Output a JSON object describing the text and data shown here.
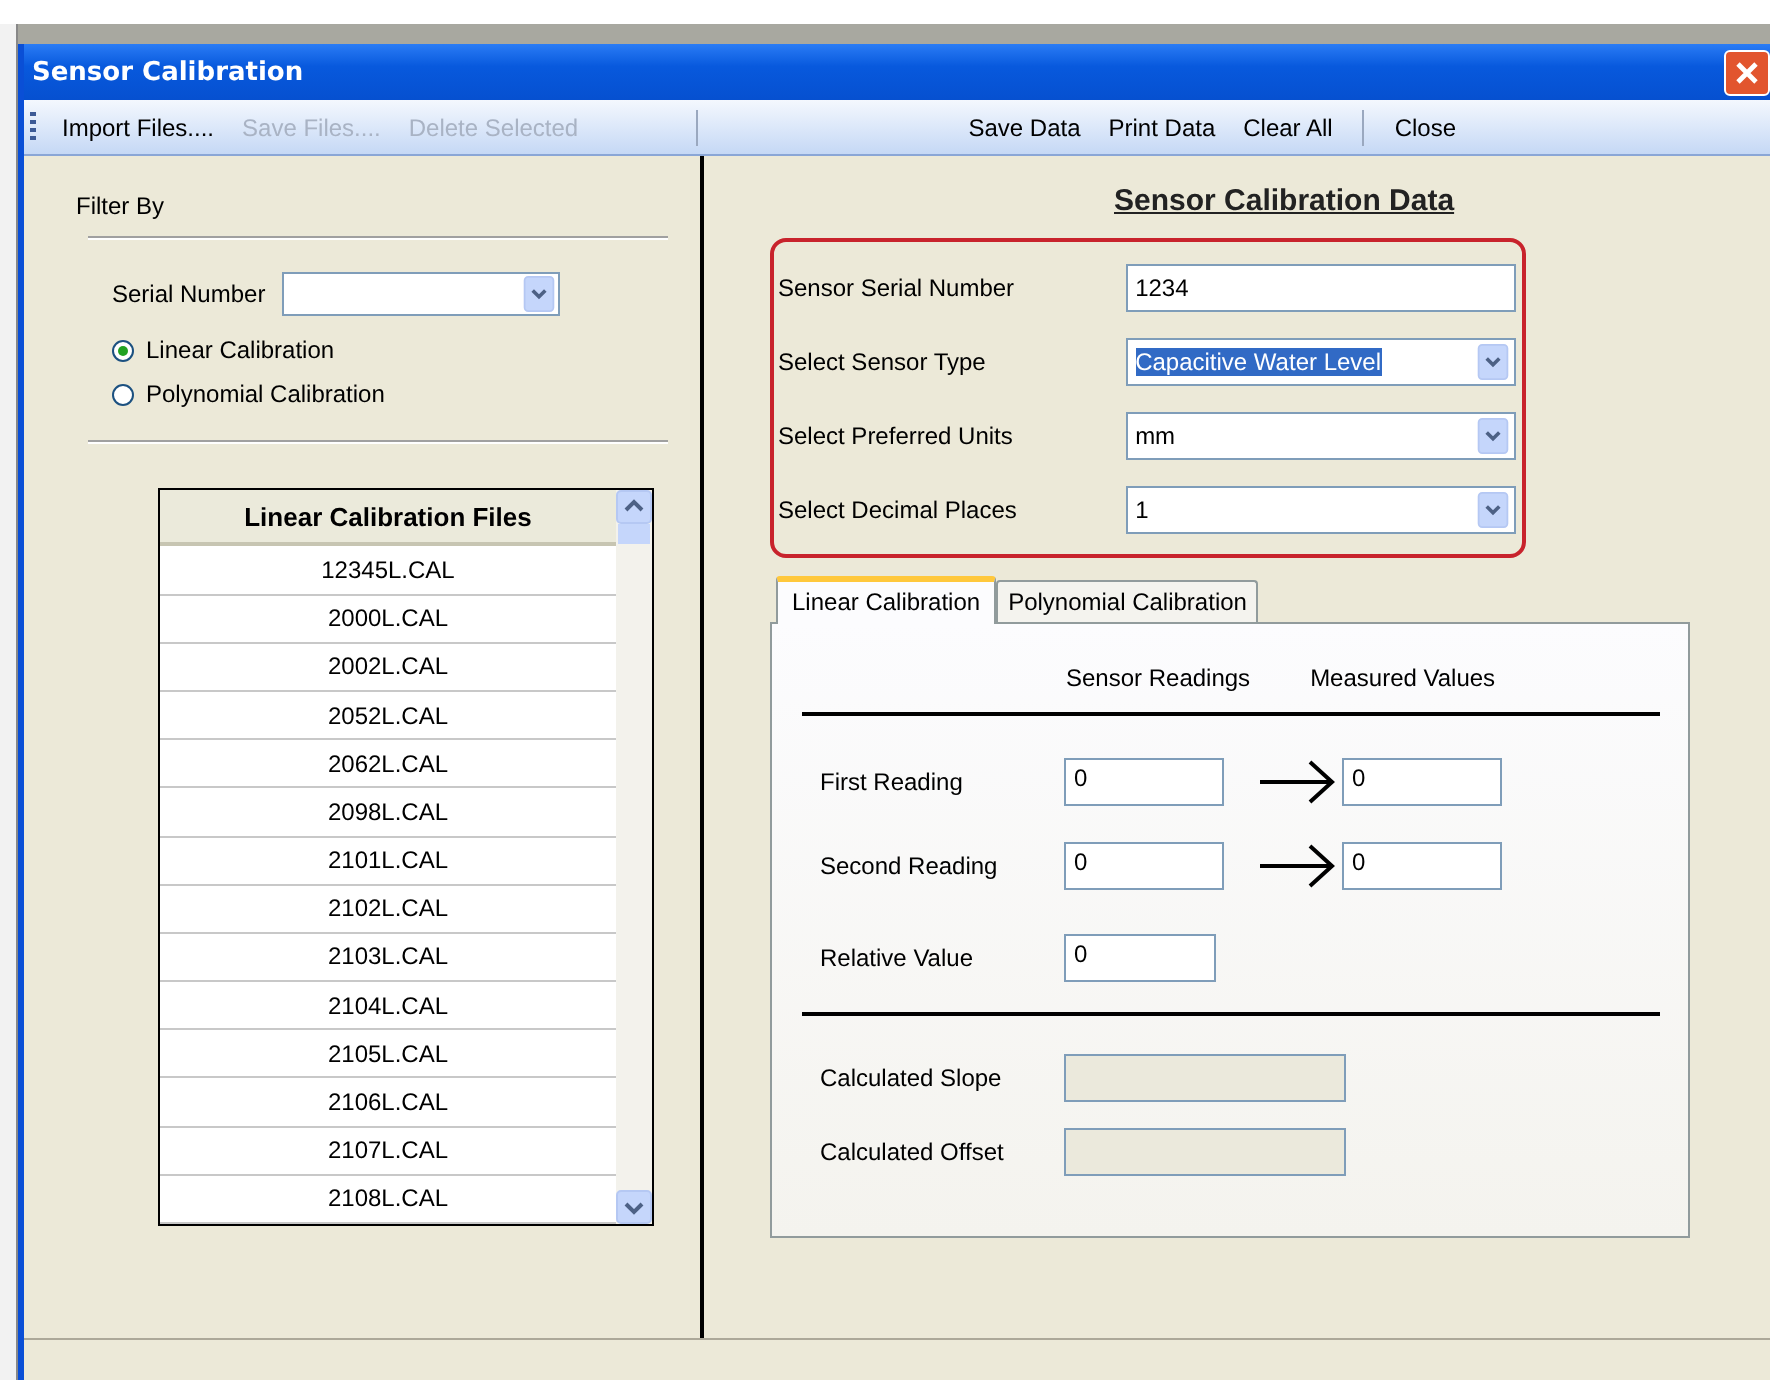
{
  "window": {
    "title": "Sensor Calibration"
  },
  "toolbar": [
    {
      "kind": "button",
      "label": "Import Files....",
      "disabled": false
    },
    {
      "kind": "button",
      "label": "Save Files....",
      "disabled": true
    },
    {
      "kind": "button",
      "label": "Delete Selected",
      "disabled": true
    },
    {
      "kind": "separator"
    },
    {
      "kind": "button",
      "label": "Save Data",
      "disabled": false
    },
    {
      "kind": "button",
      "label": "Print Data",
      "disabled": false
    },
    {
      "kind": "button",
      "label": "Clear All",
      "disabled": false
    },
    {
      "kind": "separator"
    },
    {
      "kind": "button",
      "label": "Close",
      "disabled": false
    }
  ],
  "filter": {
    "title": "Filter By",
    "serial_number": {
      "label": "Serial Number"
    },
    "radios": [
      {
        "label": "Linear Calibration",
        "selected": true
      },
      {
        "label": "Polynomial Calibration",
        "selected": false
      }
    ]
  },
  "file_list": {
    "header": "Linear Calibration Files",
    "rows": [
      "12345L.CAL",
      "2000L.CAL",
      "2002L.CAL",
      "2052L.CAL",
      "2062L.CAL",
      "2098L.CAL",
      "2101L.CAL",
      "2102L.CAL",
      "2103L.CAL",
      "2104L.CAL",
      "2105L.CAL",
      "2106L.CAL",
      "2107L.CAL",
      "2108L.CAL"
    ]
  },
  "data_panel": {
    "title": "Sensor Calibration Data",
    "fields": [
      {
        "kind": "text",
        "label": "Sensor Serial Number",
        "value": "1234",
        "text_selected": false
      },
      {
        "kind": "dropdown",
        "label": "Select Sensor Type",
        "value": "Capacitive Water Level",
        "text_selected": true
      },
      {
        "kind": "dropdown",
        "label": "Select Preferred Units",
        "value": "mm",
        "text_selected": false
      },
      {
        "kind": "dropdown",
        "label": "Select Decimal Places",
        "value": "1",
        "text_selected": false
      }
    ]
  },
  "tabs": [
    {
      "label": "Linear Calibration",
      "selected": true
    },
    {
      "label": "Polynomial Calibration",
      "selected": false
    }
  ],
  "calibration": {
    "columns": [
      "Sensor Readings",
      "Measured Values"
    ],
    "readings": [
      {
        "label": "First Reading",
        "sensor": "0",
        "measured": "0"
      },
      {
        "label": "Second Reading",
        "sensor": "0",
        "measured": "0"
      }
    ],
    "relative": {
      "label": "Relative Value",
      "value": "0"
    },
    "results": [
      {
        "label": "Calculated Slope",
        "disabled": true
      },
      {
        "label": "Calculated Offset",
        "disabled": true
      }
    ]
  }
}
